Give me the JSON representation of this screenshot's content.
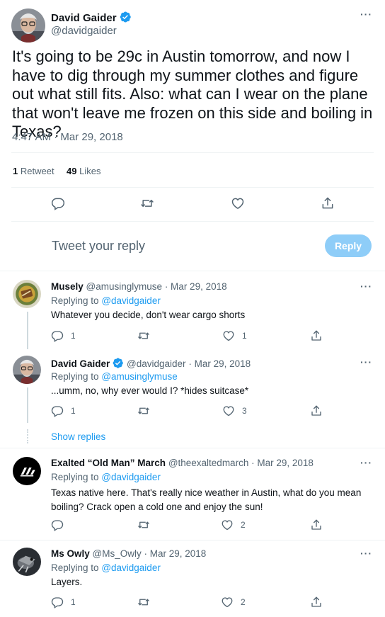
{
  "main_tweet": {
    "author_name": "David Gaider",
    "handle": "@davidgaider",
    "text": "It's going to be 29c in Austin tomorrow, and now I have to dig through my summer clothes and figure out what still fits. Also: what can I wear on the plane that won't leave me frozen on this side and boiling in Texas?",
    "timestamp": "4:47 AM · Mar 29, 2018",
    "retweet_count": "1",
    "retweet_label": "Retweet",
    "like_count": "49",
    "like_label": "Likes"
  },
  "compose": {
    "placeholder": "Tweet your reply",
    "reply_button": "Reply"
  },
  "replies": [
    {
      "author_name": "Musely",
      "handle": "@amusinglymuse",
      "date": "· Mar 29, 2018",
      "replying_prefix": "Replying to",
      "replying_to": "@davidgaider",
      "text": "Whatever you decide, don't wear cargo shorts",
      "reply_count": "1",
      "like_count": "1"
    },
    {
      "author_name": "David Gaider",
      "handle": "@davidgaider",
      "date": "· Mar 29, 2018",
      "replying_prefix": "Replying to",
      "replying_to": "@amusinglymuse",
      "text": "...umm, no, why ever would I? *hides suitcase*",
      "reply_count": "1",
      "like_count": "3"
    },
    {
      "author_name": "Exalted “Old Man” March",
      "handle": "@theexaltedmarch",
      "date": "· Mar 29, 2018",
      "replying_prefix": "Replying to",
      "replying_to": "@davidgaider",
      "text_line1": "Texas native here. That's really nice weather in Austin, what do you mean",
      "text_line2": "boiling? Crack open a cold one and enjoy the sun!",
      "like_count": "2"
    },
    {
      "author_name": "Ms Owly",
      "handle": "@Ms_Owly",
      "date": "· Mar 29, 2018",
      "replying_prefix": "Replying to",
      "replying_to": "@davidgaider",
      "text": "Layers.",
      "reply_count": "1",
      "like_count": "2"
    }
  ],
  "show_replies": "Show replies",
  "colors": {
    "accent": "#1d9bf0",
    "muted": "#536471",
    "reply_button_bg": "#8ecdf8",
    "divider": "#eff3f4"
  },
  "icons": [
    "verified-badge-icon",
    "more-icon",
    "reply-icon",
    "retweet-icon",
    "like-icon",
    "share-icon"
  ]
}
